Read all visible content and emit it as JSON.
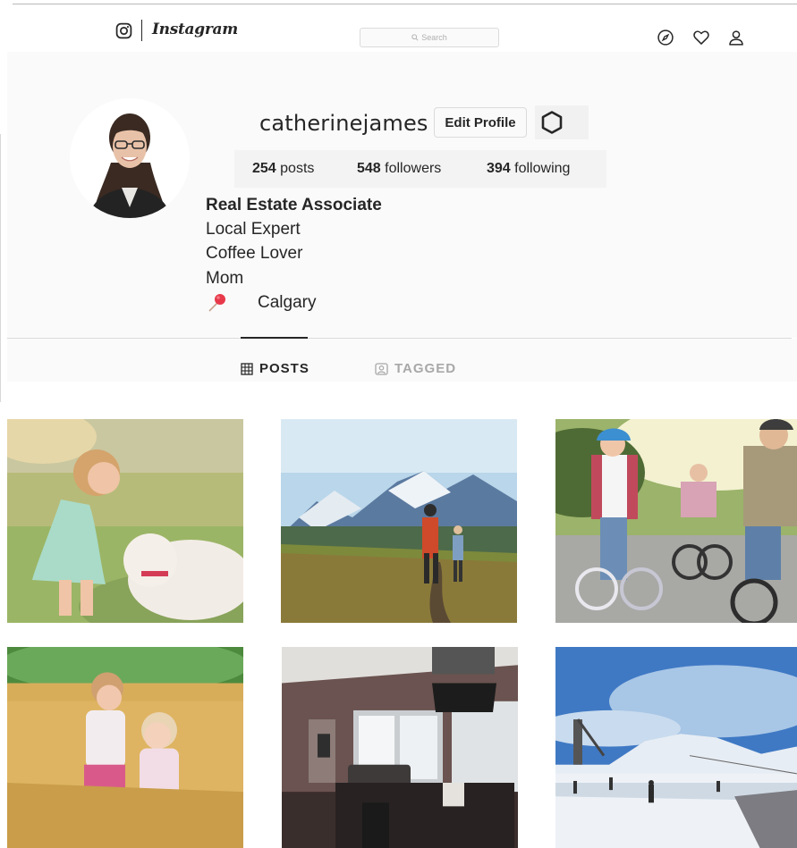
{
  "header": {
    "logo_icon": "instagram-camera-icon",
    "logo_text": "Instagram",
    "search_placeholder": "Search",
    "nav_icons": [
      "compass-icon",
      "heart-icon",
      "person-icon"
    ]
  },
  "profile": {
    "username": "catherinejames",
    "edit_label": "Edit Profile",
    "settings_icon": "gear-icon",
    "stats": {
      "posts_count": "254",
      "posts_label": "posts",
      "followers_count": "548",
      "followers_label": "followers",
      "following_count": "394",
      "following_label": "following"
    },
    "bio": {
      "title": "Real Estate Associate",
      "lines": [
        "Local Expert",
        "Coffee Lover",
        "Mom"
      ],
      "location_icon": "pushpin-icon",
      "location": "Calgary"
    }
  },
  "tabs": [
    {
      "label": "POSTS",
      "icon": "grid-icon",
      "active": true
    },
    {
      "label": "TAGGED",
      "icon": "tagged-icon",
      "active": false
    }
  ],
  "posts": [
    {
      "subject": "girl-with-dog"
    },
    {
      "subject": "hikers-mountains"
    },
    {
      "subject": "family-cycling"
    },
    {
      "subject": "girls-in-wheat-field"
    },
    {
      "subject": "living-room-interior"
    },
    {
      "subject": "ski-hill"
    }
  ],
  "colors": {
    "text": "#262626",
    "muted": "#a8a8a8",
    "border": "#dbdbdb",
    "panel": "#fafafa",
    "pin": "#e8394a"
  }
}
